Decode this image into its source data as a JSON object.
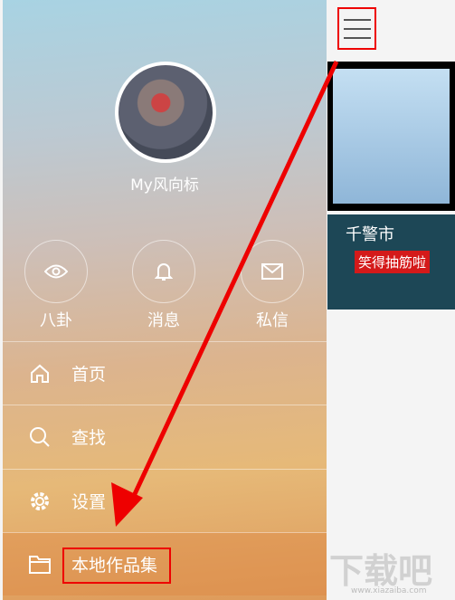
{
  "drawer": {
    "username": "My风向标",
    "quick_actions": [
      {
        "label": "八卦",
        "icon": "eye-icon"
      },
      {
        "label": "消息",
        "icon": "bell-icon"
      },
      {
        "label": "私信",
        "icon": "mail-icon"
      }
    ],
    "menu": [
      {
        "label": "首页",
        "icon": "home-icon"
      },
      {
        "label": "查找",
        "icon": "search-icon"
      },
      {
        "label": "设置",
        "icon": "gear-icon"
      },
      {
        "label": "本地作品集",
        "icon": "folder-icon"
      }
    ]
  },
  "feed": {
    "video_caption": "笑得抽筋啦",
    "video_text": "千警市"
  },
  "watermark": {
    "logo": "下载吧",
    "url": "www.xiazaiba.com"
  },
  "colors": {
    "annotation": "#e00000"
  }
}
